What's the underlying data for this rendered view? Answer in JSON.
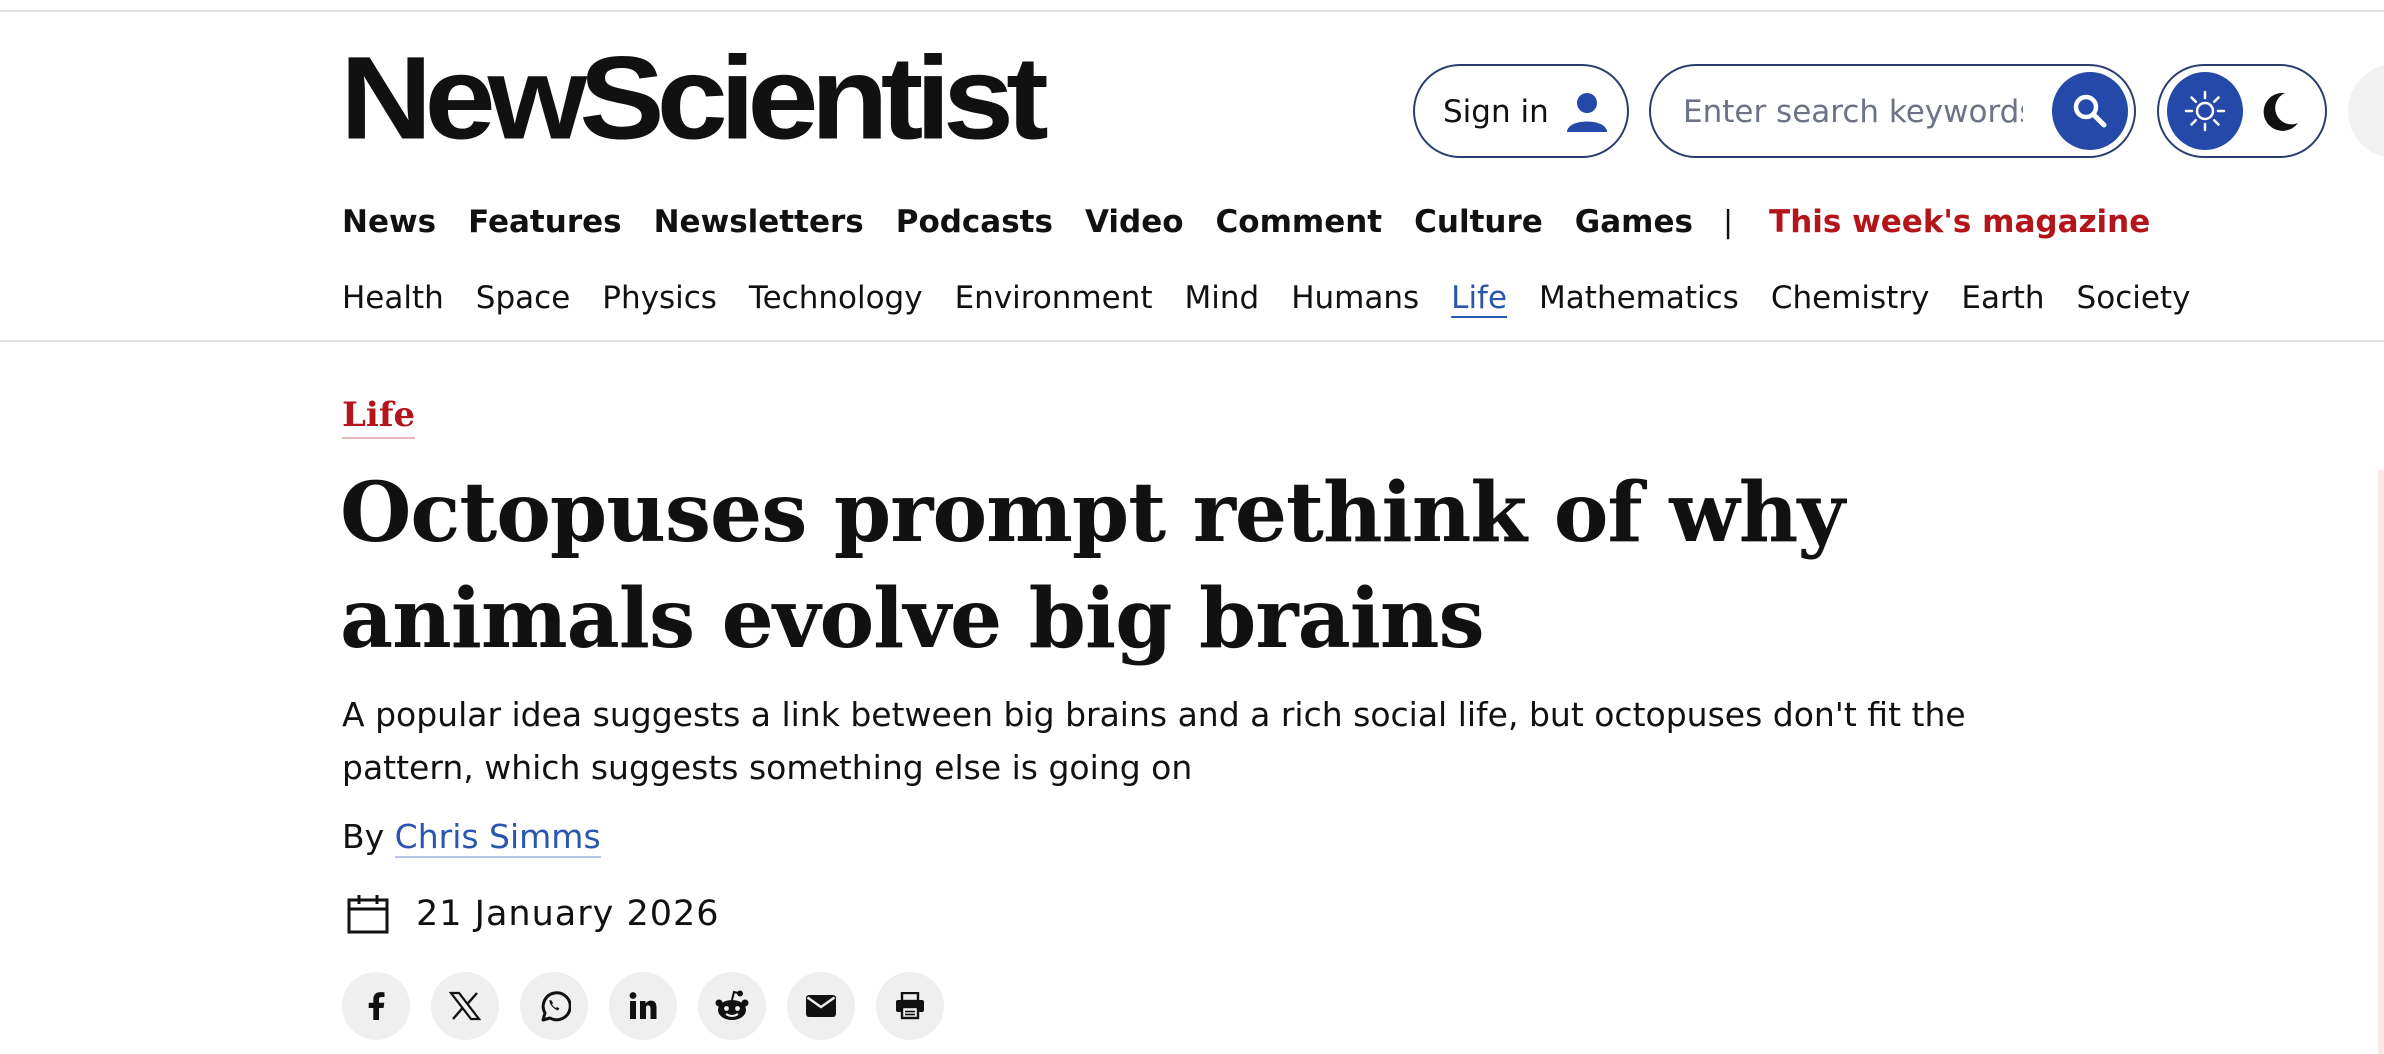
{
  "brand": {
    "logo_text": "NewScientist"
  },
  "header": {
    "signin_label": "Sign in",
    "search_placeholder": "Enter search keywords"
  },
  "main_nav": {
    "items": [
      "News",
      "Features",
      "Newsletters",
      "Podcasts",
      "Video",
      "Comment",
      "Culture",
      "Games"
    ],
    "separator": "|",
    "magazine_link": "This week's magazine"
  },
  "topic_nav": {
    "items": [
      "Health",
      "Space",
      "Physics",
      "Technology",
      "Environment",
      "Mind",
      "Humans",
      "Life",
      "Mathematics",
      "Chemistry",
      "Earth",
      "Society"
    ],
    "active": "Life"
  },
  "article": {
    "section": "Life",
    "headline": "Octopuses prompt rethink of why animals evolve big brains",
    "standfirst": "A popular idea suggests a link between big brains and a rich social life, but octopuses don't fit the pattern, which suggests something else is going on",
    "byline_prefix": "By",
    "author": "Chris Simms",
    "date": "21 January 2026"
  },
  "share_icons": [
    "facebook-icon",
    "x-icon",
    "whatsapp-icon",
    "linkedin-icon",
    "reddit-icon",
    "email-icon",
    "print-icon"
  ],
  "colors": {
    "accent_blue": "#2549a8",
    "link_blue": "#2a56b0",
    "brand_red": "#b3151b",
    "pill_border": "#2a3d6e"
  }
}
